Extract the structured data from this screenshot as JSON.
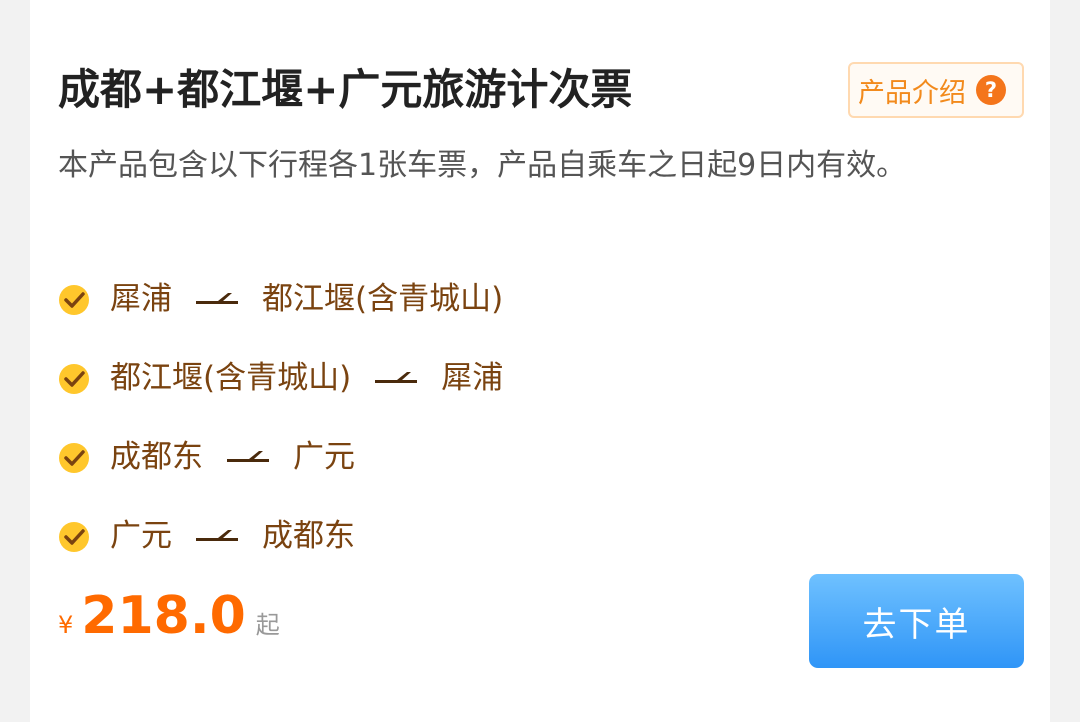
{
  "product": {
    "title": "成都+都江堰+广元旅游计次票",
    "intro_button": "产品介绍",
    "help_icon": "?",
    "description": "本产品包含以下行程各1张车票，产品自乘车之日起9日内有效。"
  },
  "routes": [
    {
      "from": "犀浦",
      "to": "都江堰(含青城山)"
    },
    {
      "from": "都江堰(含青城山)",
      "to": "犀浦"
    },
    {
      "from": "成都东",
      "to": "广元"
    },
    {
      "from": "广元",
      "to": "成都东"
    }
  ],
  "price": {
    "currency": "¥",
    "amount": "218.0",
    "suffix": "起"
  },
  "order_button": "去下单",
  "icons": {
    "check": "check-circle-icon",
    "arrow": "arrow-right-icon",
    "help": "help-circle-icon"
  },
  "colors": {
    "accent_orange": "#ff6a00",
    "route_brown": "#7a4310",
    "check_yellow": "#ffc72c",
    "button_blue": "#2f95f7"
  }
}
